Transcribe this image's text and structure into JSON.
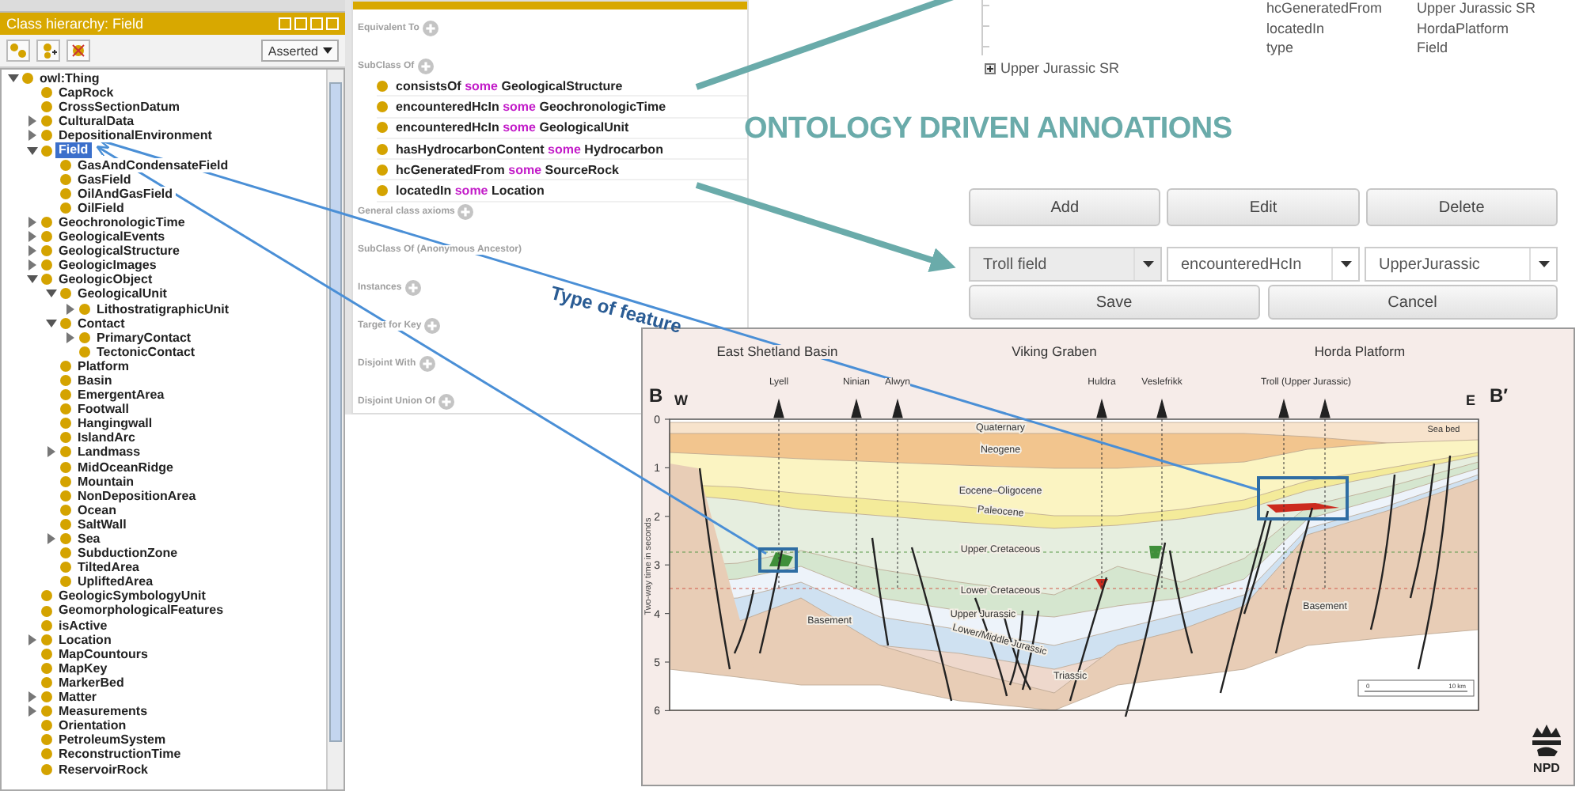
{
  "class_panel": {
    "title": "Class hierarchy: Field",
    "view_mode": "Asserted",
    "tree": [
      {
        "label": "owl:Thing",
        "expanded": true,
        "selected": false,
        "children": [
          {
            "label": "CapRock",
            "selected": false
          },
          {
            "label": "CrossSectionDatum",
            "selected": false
          },
          {
            "label": "CulturalData",
            "expanded": false,
            "selected": false
          },
          {
            "label": "DepositionalEnvironment",
            "expanded": false,
            "selected": false
          },
          {
            "label": "Field",
            "expanded": true,
            "selected": true,
            "children": [
              {
                "label": "GasAndCondensateField",
                "selected": false
              },
              {
                "label": "GasField",
                "selected": false
              },
              {
                "label": "OilAndGasField",
                "selected": false
              },
              {
                "label": "OilField",
                "selected": false
              }
            ]
          },
          {
            "label": "GeochronologicTime",
            "expanded": false,
            "selected": false
          },
          {
            "label": "GeologicalEvents",
            "expanded": false,
            "selected": false
          },
          {
            "label": "GeologicalStructure",
            "expanded": false,
            "selected": false
          },
          {
            "label": "GeologicImages",
            "expanded": false,
            "selected": false
          },
          {
            "label": "GeologicObject",
            "expanded": true,
            "selected": false,
            "children": [
              {
                "label": "GeologicalUnit",
                "expanded": true,
                "selected": false,
                "children": [
                  {
                    "label": "LithostratigraphicUnit",
                    "expanded": false,
                    "selected": false
                  }
                ]
              },
              {
                "label": "Contact",
                "expanded": true,
                "selected": false,
                "children": [
                  {
                    "label": "PrimaryContact",
                    "expanded": false,
                    "selected": false
                  },
                  {
                    "label": "TectonicContact",
                    "selected": false
                  }
                ]
              },
              {
                "label": "Platform",
                "selected": false
              },
              {
                "label": "Basin",
                "selected": false
              },
              {
                "label": "EmergentArea",
                "selected": false
              },
              {
                "label": "Footwall",
                "selected": false
              },
              {
                "label": "Hangingwall",
                "selected": false
              },
              {
                "label": "IslandArc",
                "selected": false
              },
              {
                "label": "Landmass",
                "expanded": false,
                "selected": false
              },
              {
                "label": "MidOceanRidge",
                "selected": false
              },
              {
                "label": "Mountain",
                "selected": false
              },
              {
                "label": "NonDepositionArea",
                "selected": false
              },
              {
                "label": "Ocean",
                "selected": false
              },
              {
                "label": "SaltWall",
                "selected": false
              },
              {
                "label": "Sea",
                "expanded": false,
                "selected": false
              },
              {
                "label": "SubductionZone",
                "selected": false
              },
              {
                "label": "TiltedArea",
                "selected": false
              },
              {
                "label": "UpliftedArea",
                "selected": false
              }
            ]
          },
          {
            "label": "GeologicSymbologyUnit",
            "selected": false
          },
          {
            "label": "GeomorphologicalFeatures",
            "selected": false
          },
          {
            "label": "isActive",
            "selected": false
          },
          {
            "label": "Location",
            "expanded": false,
            "selected": false
          },
          {
            "label": "MapCountours",
            "selected": false
          },
          {
            "label": "MapKey",
            "selected": false
          },
          {
            "label": "MarkerBed",
            "selected": false
          },
          {
            "label": "Matter",
            "expanded": false,
            "selected": false
          },
          {
            "label": "Measurements",
            "expanded": false,
            "selected": false
          },
          {
            "label": "Orientation",
            "selected": false
          },
          {
            "label": "PetroleumSystem",
            "selected": false
          },
          {
            "label": "ReconstructionTime",
            "selected": false
          },
          {
            "label": "ReservoirRock",
            "selected": false
          }
        ]
      }
    ]
  },
  "description_panel": {
    "sections": [
      {
        "label": "Equivalent To",
        "has_add": true
      },
      {
        "label": "SubClass Of",
        "has_add": true,
        "items": [
          {
            "property": "consistsOf",
            "keyword": "some",
            "filler": "GeologicalStructure"
          },
          {
            "property": "encounteredHcIn",
            "keyword": "some",
            "filler": "GeochronologicTime"
          },
          {
            "property": "encounteredHcIn",
            "keyword": "some",
            "filler": "GeologicalUnit"
          },
          {
            "property": "hasHydrocarbonContent",
            "keyword": "some",
            "filler": "Hydrocarbon"
          },
          {
            "property": "hcGeneratedFrom",
            "keyword": "some",
            "filler": "SourceRock"
          },
          {
            "property": "locatedIn",
            "keyword": "some",
            "filler": "Location"
          }
        ]
      },
      {
        "label": "General class axioms",
        "has_add": true
      },
      {
        "label": "SubClass Of (Anonymous Ancestor)",
        "has_add": false
      },
      {
        "label": "Instances",
        "has_add": true
      },
      {
        "label": "Target for Key",
        "has_add": true
      },
      {
        "label": "Disjoint With",
        "has_add": true
      },
      {
        "label": "Disjoint Union Of",
        "has_add": true
      }
    ]
  },
  "instance_tree": {
    "items": [
      {
        "label": "Upper Jurassic SR",
        "expanded": false
      }
    ]
  },
  "properties": [
    {
      "name": "hcGeneratedFrom",
      "value": "Upper Jurassic SR"
    },
    {
      "name": "locatedIn",
      "value": "HordaPlatform"
    },
    {
      "name": "type",
      "value": "Field"
    }
  ],
  "annotation_title": "ONTOLOGY DRIVEN ANNOATIONS",
  "callout": "Type of feature",
  "form": {
    "buttons": [
      "Add",
      "Edit",
      "Delete"
    ],
    "selects": [
      {
        "value": "Troll field",
        "readonly": true
      },
      {
        "value": "encounteredHcIn",
        "readonly": false
      },
      {
        "value": "UpperJurassic",
        "readonly": false
      }
    ],
    "actions": [
      "Save",
      "Cancel"
    ]
  },
  "cross_section": {
    "regions": [
      "East Shetland Basin",
      "Viking Graben",
      "Horda Platform"
    ],
    "wells": [
      "Lyell",
      "Ninian",
      "Alwyn",
      "Huldra",
      "Veslefrikk",
      "Troll (Upper Jurassic)"
    ],
    "section_ends": [
      "B",
      "W",
      "E",
      "B′"
    ],
    "yticks": [
      "0",
      "1",
      "2",
      "3",
      "4",
      "5",
      "6"
    ],
    "ylabel": "Two-way time in seconds",
    "units": [
      "Quaternary",
      "Neogene",
      "Eocene–Oligocene",
      "Paleocene",
      "Upper Cretaceous",
      "Lower Cretaceous",
      "Upper Jurassic",
      "Lower/Middle Jurassic",
      "Triassic",
      "Basement",
      "Basement"
    ],
    "sea_bed": "Sea bed",
    "scale": [
      "0",
      "10 km"
    ],
    "logo": "NPD"
  }
}
